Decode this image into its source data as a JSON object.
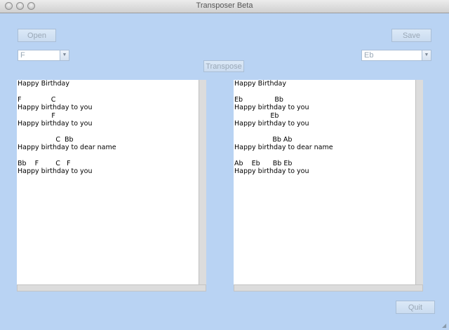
{
  "window": {
    "title": "Transposer Beta"
  },
  "buttons": {
    "open": "Open",
    "save": "Save",
    "transpose": "Transpose",
    "quit": "Quit"
  },
  "source_key": {
    "selected": "F"
  },
  "target_key": {
    "selected": "Eb"
  },
  "source_text": "Happy Birthday\n\nF              C\nHappy birthday to you\n                F\nHappy birthday to you\n\n                  C  Bb\nHappy birthday to dear name\n\nBb    F        C   F\nHappy birthday to you",
  "target_text": "Happy Birthday\n\nEb               Bb\nHappy birthday to you\n                 Eb\nHappy birthday to you\n\n                  Bb Ab\nHappy birthday to dear name\n\nAb    Eb      Bb Eb\nHappy birthday to you",
  "icons": {
    "dropdown": "chevron-down-icon",
    "traffic": "window-control-icon",
    "grip": "resize-grip-icon"
  }
}
